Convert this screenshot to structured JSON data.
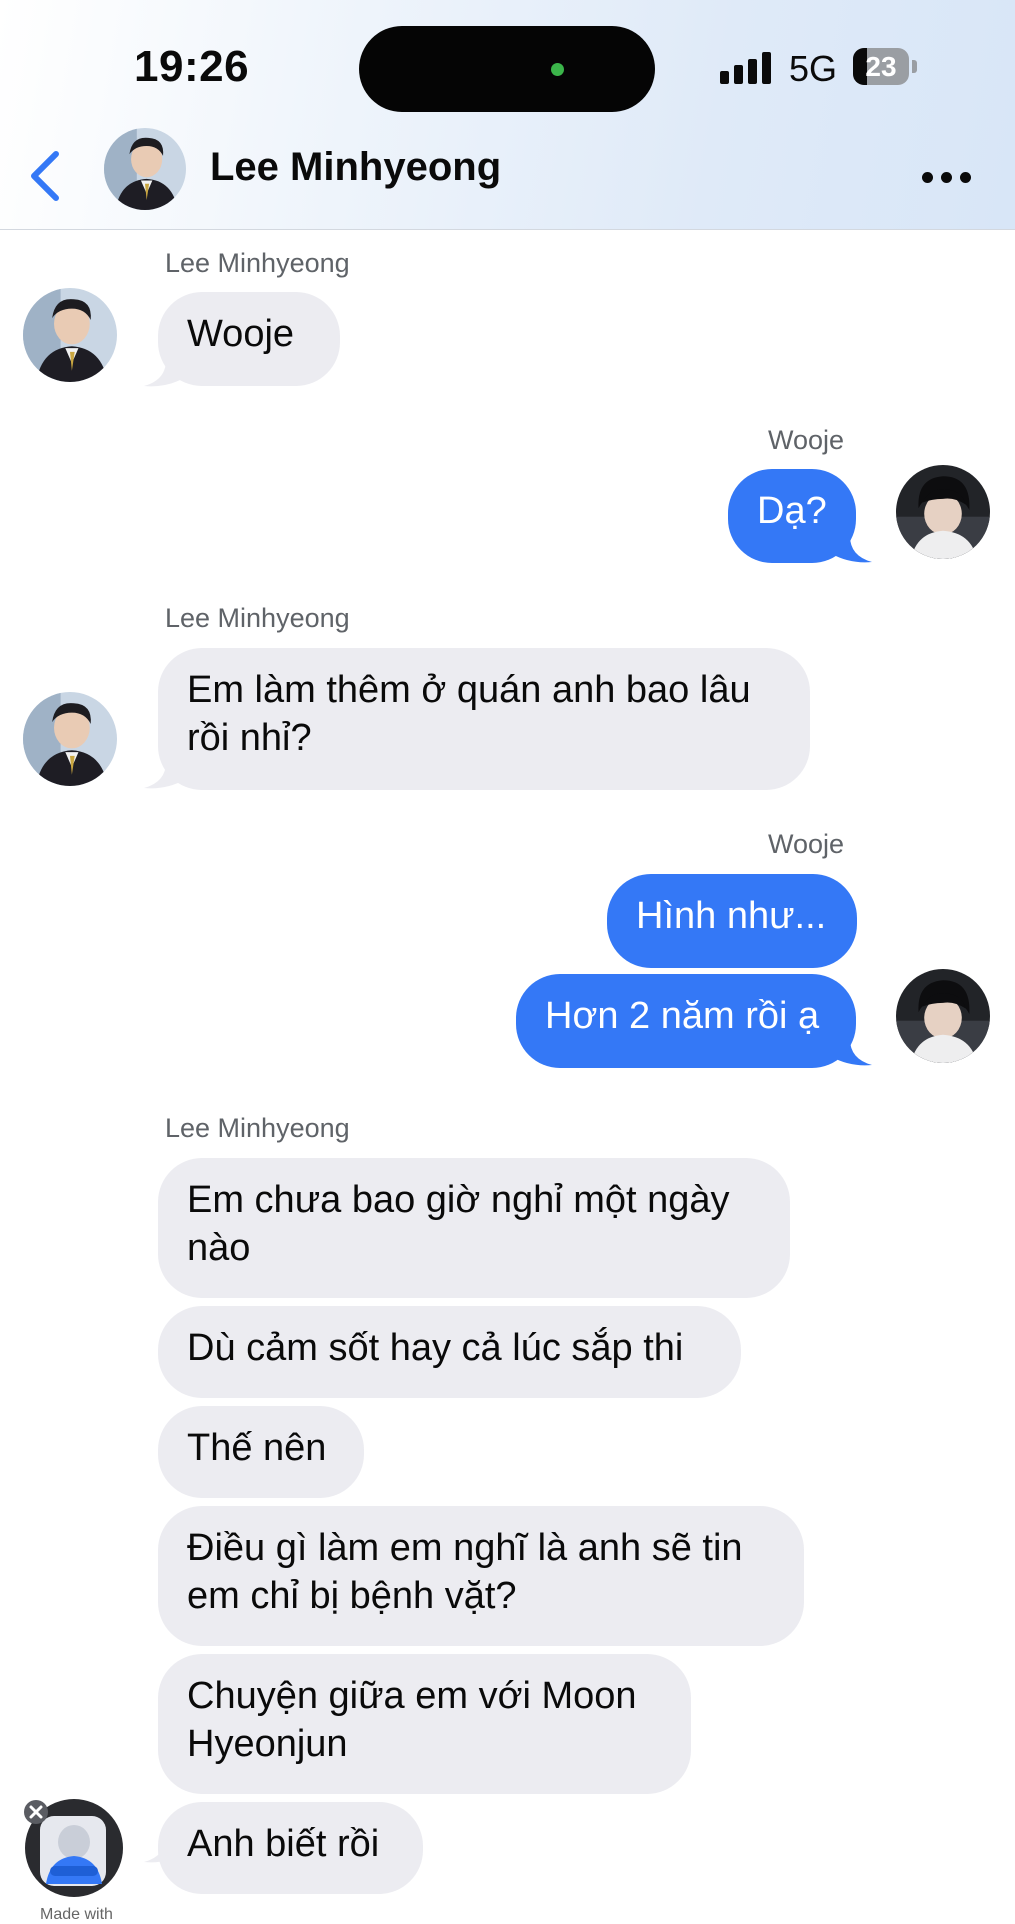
{
  "status_bar": {
    "time": "19:26",
    "network": "5G",
    "battery": "23"
  },
  "header": {
    "back_icon": "chevron-left-icon",
    "contact_name": "Lee Minhyeong",
    "more_icon": "ellipsis-icon",
    "accent_color": "#3478f6"
  },
  "messages": [
    {
      "sender": "Lee Minhyeong",
      "direction": "incoming",
      "text": "Wooje"
    },
    {
      "sender": "Wooje",
      "direction": "outgoing",
      "text": "Dạ?"
    },
    {
      "sender": "Lee Minhyeong",
      "direction": "incoming",
      "lines": [
        "Em làm thêm ở quán anh bao lâu",
        "rồi nhỉ?"
      ]
    },
    {
      "sender": "Wooje",
      "direction": "outgoing",
      "text": "Hình như..."
    },
    {
      "direction": "outgoing",
      "text": "Hơn 2 năm rồi ạ"
    },
    {
      "sender": "Lee Minhyeong",
      "direction": "incoming",
      "lines": [
        "Em chưa bao giờ nghỉ một ngày",
        "nào"
      ]
    },
    {
      "direction": "incoming",
      "text": "Dù cảm sốt hay cả lúc sắp thi"
    },
    {
      "direction": "incoming",
      "text": "Thế nên"
    },
    {
      "direction": "incoming",
      "lines": [
        "Điều gì làm em nghĩ là anh sẽ tin",
        "em chỉ bị bệnh vặt?"
      ]
    },
    {
      "direction": "incoming",
      "lines": [
        "Chuyện giữa em với Moon",
        "Hyeonjun"
      ]
    },
    {
      "direction": "incoming",
      "text": "Anh biết rồi"
    }
  ],
  "watermark": {
    "text": "Made with"
  },
  "colors": {
    "incoming_bubble": "#ececf1",
    "outgoing_bubble": "#3478f6"
  }
}
